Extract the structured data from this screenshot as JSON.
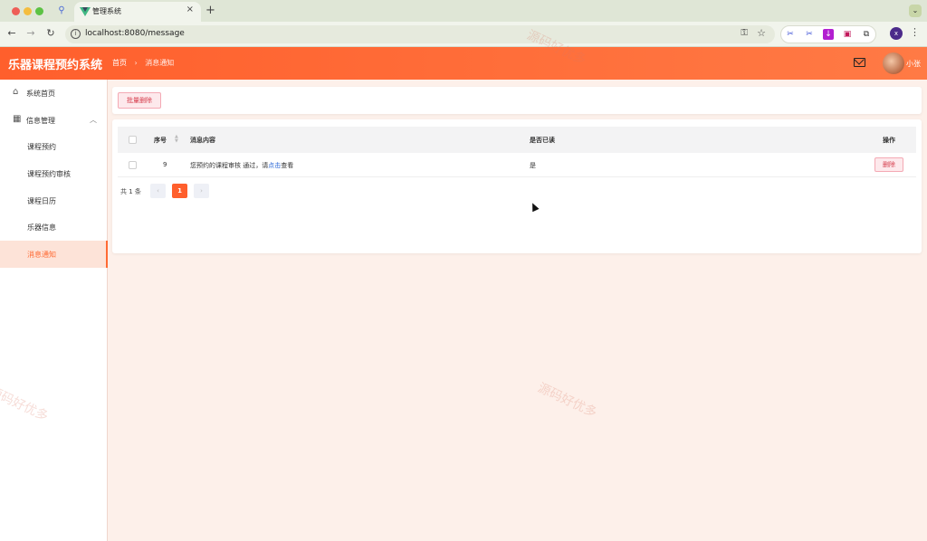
{
  "browser": {
    "tab_title": "管理系统",
    "url": "localhost:8080/message",
    "profile_initial": "x"
  },
  "header": {
    "brand": "乐器课程预约系统",
    "breadcrumb_home": "首页",
    "breadcrumb_current": "消息通知",
    "username": "小张"
  },
  "sidebar": {
    "items": [
      {
        "label": "系统首页"
      },
      {
        "label": "信息管理"
      },
      {
        "label": "课程预约"
      },
      {
        "label": "课程预约审核"
      },
      {
        "label": "课程日历"
      },
      {
        "label": "乐器信息"
      },
      {
        "label": "消息通知"
      }
    ]
  },
  "toolbar": {
    "batch_delete": "批量删除"
  },
  "table": {
    "columns": [
      "序号",
      "消息内容",
      "是否已读",
      "操作"
    ],
    "rows": [
      {
        "index": "9",
        "content_prefix": "您预约的课程审核 通过，请",
        "content_link": "点击",
        "content_suffix": "查看",
        "read": "是",
        "action": "删除"
      }
    ]
  },
  "pagination": {
    "total": "共 1 条",
    "prev": "‹",
    "current": "1",
    "next": "›"
  },
  "watermark": "源码好优多",
  "colors": {
    "brand": "#ff5f2c",
    "danger": "#d53a4a",
    "link": "#2563d6"
  }
}
